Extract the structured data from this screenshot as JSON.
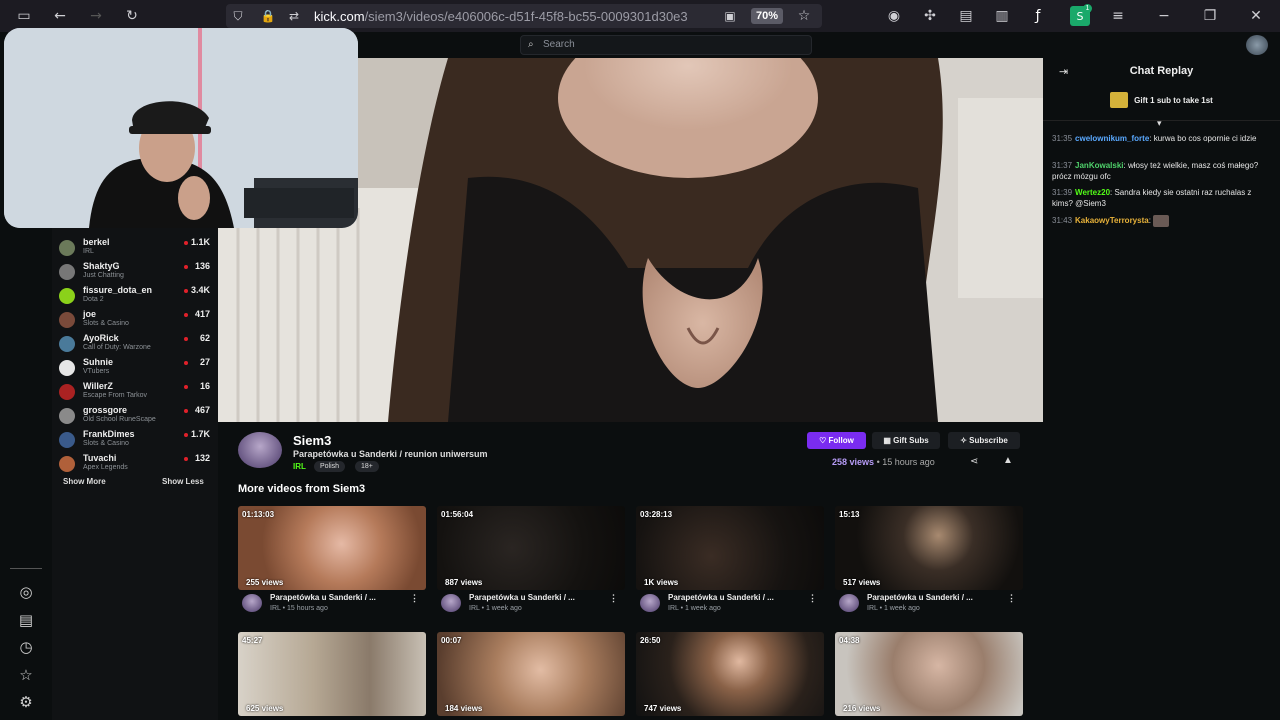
{
  "browser": {
    "url_host": "kick.com",
    "url_path": "/siem3/videos/e406006c-d51f-45f8-bc55-0009301d30e3",
    "zoom": "70%",
    "extension_badge": "1"
  },
  "header": {
    "search_placeholder": "Search"
  },
  "sidebar": {
    "channels": [
      {
        "name": "berkel",
        "category": "IRL",
        "viewers": "1.1K",
        "color": "#6b7a5a"
      },
      {
        "name": "ShaktyG",
        "category": "Just Chatting",
        "viewers": "136",
        "color": "#777777"
      },
      {
        "name": "fissure_dota_en",
        "category": "Dota 2",
        "viewers": "3.4K",
        "color": "#8bd11a"
      },
      {
        "name": "joe",
        "category": "Slots & Casino",
        "viewers": "417",
        "color": "#7a4a3a"
      },
      {
        "name": "AyoRick",
        "category": "Call of Duty: Warzone",
        "viewers": "62",
        "color": "#4a7a9a"
      },
      {
        "name": "Suhnie",
        "category": "VTubers",
        "viewers": "27",
        "color": "#e6e6e6"
      },
      {
        "name": "WillerZ",
        "category": "Escape From Tarkov",
        "viewers": "16",
        "color": "#aa2222"
      },
      {
        "name": "grossgore",
        "category": "Old School RuneScape",
        "viewers": "467",
        "color": "#8a8a8a"
      },
      {
        "name": "FrankDimes",
        "category": "Slots & Casino",
        "viewers": "1.7K",
        "color": "#3a5a8a"
      },
      {
        "name": "Tuvachi",
        "category": "Apex Legends",
        "viewers": "132",
        "color": "#b0603a"
      }
    ],
    "show_more": "Show More",
    "show_less": "Show Less"
  },
  "chat": {
    "title": "Chat Replay",
    "gift_text": "Gift 1 sub to take 1st",
    "messages": [
      {
        "time": "31:35",
        "user": "cwelownikum_forte",
        "color": "#5aa9ff",
        "text": "kurwa bo cos opornie ci idzie"
      },
      {
        "time": "31:37",
        "user": "JanKowalski",
        "color": "#4fd16b",
        "text": "włosy też wielkie, masz coś małego? prócz mózgu ofc"
      },
      {
        "time": "31:39",
        "user": "Wertez20",
        "color": "#53fc18",
        "text": "Sandra kiedy sie ostatni raz ruchalas z kims? @Siem3"
      },
      {
        "time": "31:43",
        "user": "KakaowyTerrorysta",
        "color": "#e8b23a",
        "text": ""
      }
    ]
  },
  "channel": {
    "name": "Siem3",
    "stream_title": "Parapetówka u Sanderki / reunion uniwersum",
    "category": "IRL",
    "tags": [
      "Polish",
      "18+"
    ],
    "follow_label": "Follow",
    "gift_subs_label": "Gift Subs",
    "subscribe_label": "Subscribe",
    "views": "258 views",
    "separator": "•",
    "time_ago": "15 hours ago",
    "more_videos_title": "More videos from Siem3"
  },
  "videos": [
    {
      "duration": "01:13:03",
      "views": "255 views",
      "title": "Parapetówka u Sanderki / ...",
      "meta": "IRL • 15 hours ago",
      "bg": "#8a5a3e"
    },
    {
      "duration": "01:56:04",
      "views": "887 views",
      "title": "Parapetówka u Sanderki / ...",
      "meta": "IRL • 1 week ago",
      "bg": "#121212"
    },
    {
      "duration": "03:28:13",
      "views": "1K views",
      "title": "Parapetówka u Sanderki / ...",
      "meta": "IRL • 1 week ago",
      "bg": "#141211"
    },
    {
      "duration": "15:13",
      "views": "517 views",
      "title": "Parapetówka u Sanderki / ...",
      "meta": "IRL • 1 week ago",
      "bg": "#1a1612"
    },
    {
      "duration": "45:27",
      "views": "625 views",
      "title": "",
      "meta": "",
      "bg": "#b5aba0"
    },
    {
      "duration": "00:07",
      "views": "184 views",
      "title": "",
      "meta": "",
      "bg": "#a97d5e"
    },
    {
      "duration": "26:50",
      "views": "747 views",
      "title": "",
      "meta": "",
      "bg": "#5a4232"
    },
    {
      "duration": "04:38",
      "views": "216 views",
      "title": "",
      "meta": "",
      "bg": "#9a8a7e"
    }
  ]
}
